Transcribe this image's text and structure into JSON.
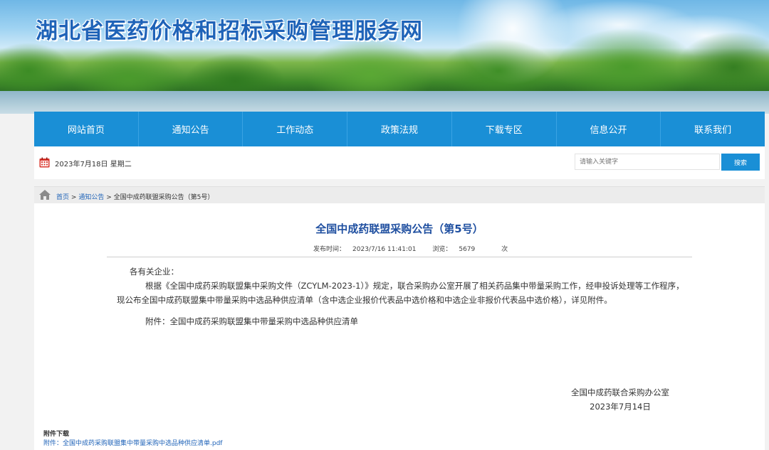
{
  "header": {
    "site_title": "湖北省医药价格和招标采购管理服务网"
  },
  "nav": {
    "items": [
      "网站首页",
      "通知公告",
      "工作动态",
      "政策法规",
      "下载专区",
      "信息公开",
      "联系我们"
    ]
  },
  "infobar": {
    "date": "2023年7月18日 星期二",
    "search_placeholder": "请输入关键字",
    "search_button": "搜索"
  },
  "breadcrumb": {
    "home": "首页",
    "sep": ">",
    "section": "通知公告",
    "current": "全国中成药联盟采购公告（第5号）"
  },
  "article": {
    "title": "全国中成药联盟采购公告（第5号）",
    "publish_label": "发布时间：",
    "publish_time": "2023/7/16 11:41:01",
    "views_label": "浏览：",
    "views": "5679",
    "views_unit": "次",
    "greeting": "各有关企业：",
    "body": "根据《全国中成药采购联盟集中采购文件（ZCYLM-2023-1）》规定，联合采购办公室开展了相关药品集中带量采购工作，经申投诉处理等工作程序，现公布全国中成药联盟集中带量采购中选品种供应清单（含中选企业报价代表品中选价格和中选企业非报价代表品中选价格），详见附件。",
    "attachment_line": "附件：全国中成药采购联盟集中带量采购中选品种供应清单",
    "signer": "全国中成药联合采购办公室",
    "sign_date": "2023年7月14日"
  },
  "download": {
    "title": "附件下载",
    "link": "附件：全国中成药采购联盟集中带量采购中选品种供应清单.pdf"
  },
  "colors": {
    "nav_bg": "#1a8fd6",
    "title_blue": "#1f4fa0",
    "link_blue": "#1f63b8"
  }
}
